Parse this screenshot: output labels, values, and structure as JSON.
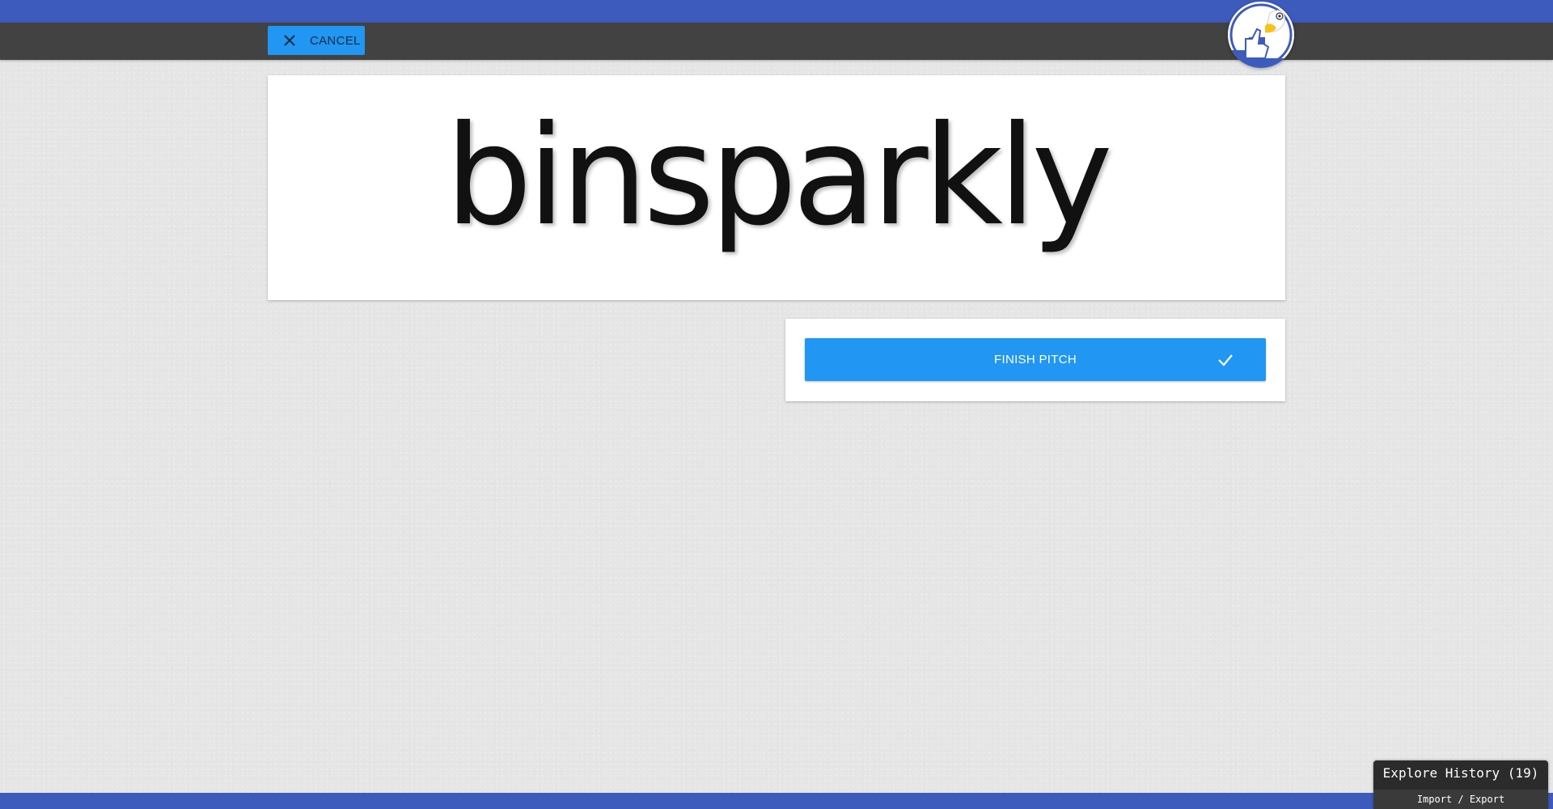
{
  "header": {
    "cancel_label": "CANCEL",
    "cancel_icon": "close-icon",
    "mascot_icon": "duck-thumbs-up-icon"
  },
  "word_card": {
    "word": "binsparkly"
  },
  "actions": {
    "finish_label": "FINISH PITCH",
    "finish_icon": "check-icon"
  },
  "history": {
    "title": "Explore History (19)",
    "subtitle": "Import / Export"
  },
  "colors": {
    "top_bar": "#3d5bbd",
    "toolbar": "#424242",
    "accent": "#2196f3",
    "background": "#e6e6e6",
    "history_panel": "#2b2b2b"
  }
}
